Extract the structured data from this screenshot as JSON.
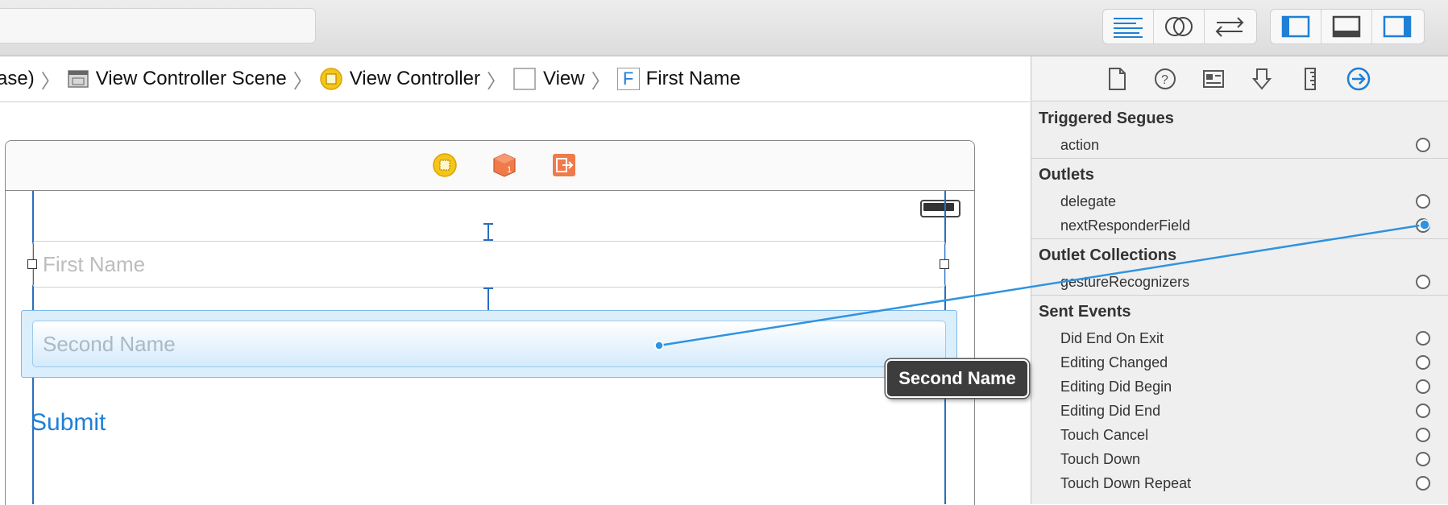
{
  "toolbar": {
    "editor_buttons": [
      "standard-editor-icon",
      "assistant-editor-icon",
      "version-editor-icon"
    ],
    "view_buttons": [
      "navigator-panel-icon",
      "debug-area-icon",
      "utilities-panel-icon"
    ]
  },
  "breadcrumb": {
    "items": [
      {
        "label": "ase)",
        "icon": "none"
      },
      {
        "label": "View Controller Scene",
        "icon": "scene-icon"
      },
      {
        "label": "View Controller",
        "icon": "view-controller-icon"
      },
      {
        "label": "View",
        "icon": "view-icon"
      },
      {
        "label": "First Name",
        "icon": "text-field-icon",
        "icon_text": "F"
      }
    ]
  },
  "canvas": {
    "first_name_placeholder": "First Name",
    "second_name_placeholder": "Second Name",
    "submit_label": "Submit",
    "tooltip": "Second Name"
  },
  "inspector": {
    "tabs": [
      "file-inspector-icon",
      "quick-help-icon",
      "identity-inspector-icon",
      "attributes-inspector-icon",
      "size-inspector-icon",
      "connections-inspector-icon"
    ],
    "sections": {
      "triggered_segues": {
        "title": "Triggered Segues",
        "items": [
          "action"
        ]
      },
      "outlets": {
        "title": "Outlets",
        "items": [
          "delegate",
          "nextResponderField"
        ]
      },
      "outlet_collections": {
        "title": "Outlet Collections",
        "items": [
          "gestureRecognizers"
        ]
      },
      "sent_events": {
        "title": "Sent Events",
        "items": [
          "Did End On Exit",
          "Editing Changed",
          "Editing Did Begin",
          "Editing Did End",
          "Touch Cancel",
          "Touch Down",
          "Touch Down Repeat"
        ]
      }
    }
  },
  "colors": {
    "accent": "#1e7fd6",
    "connection_line": "#2f93e0",
    "selection_fill": "#d9ecfb"
  }
}
